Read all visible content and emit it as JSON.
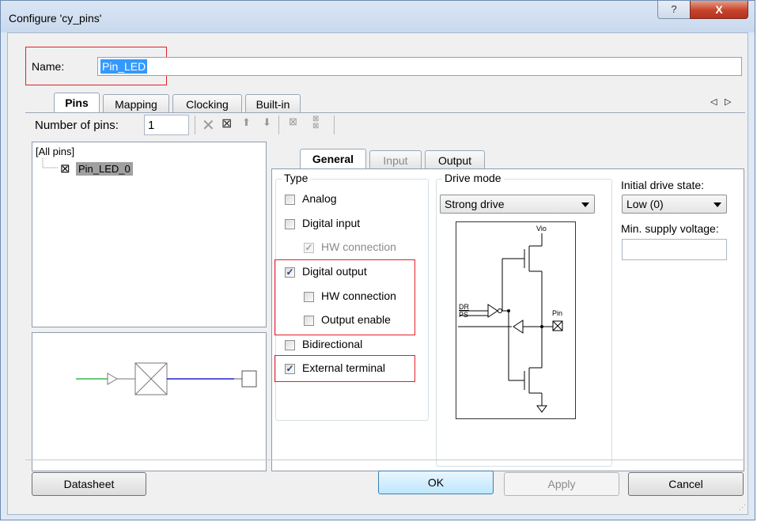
{
  "window": {
    "title": "Configure 'cy_pins'",
    "help_glyph": "?",
    "close_glyph": "X"
  },
  "name_field": {
    "label": "Name:",
    "value": "Pin_LED"
  },
  "top_tabs": [
    {
      "label": "Pins",
      "active": true
    },
    {
      "label": "Mapping",
      "active": false
    },
    {
      "label": "Clocking",
      "active": false
    },
    {
      "label": "Built-in",
      "active": false
    }
  ],
  "tab_scroll": {
    "left": "◁",
    "right": "▷"
  },
  "toolbar": {
    "pins_label": "Number of pins:",
    "pins_value": "1",
    "icons": [
      "delete-icon",
      "add-pin-icon",
      "move-up-icon",
      "move-down-icon",
      "spread-pins-icon",
      "contiguous-pins-icon"
    ]
  },
  "pin_tree": {
    "root": "[All pins]",
    "items": [
      "Pin_LED_0"
    ]
  },
  "sub_tabs": [
    {
      "label": "General",
      "active": true
    },
    {
      "label": "Input",
      "active": false
    },
    {
      "label": "Output",
      "active": false
    }
  ],
  "type_group": {
    "label": "Type",
    "analog": {
      "label": "Analog",
      "checked": false
    },
    "digital_input": {
      "label": "Digital input",
      "checked": false
    },
    "di_hw_connection": {
      "label": "HW connection",
      "checked": true,
      "disabled": true
    },
    "digital_output": {
      "label": "Digital output",
      "checked": true
    },
    "do_hw_connection": {
      "label": "HW connection",
      "checked": false
    },
    "output_enable": {
      "label": "Output enable",
      "checked": false
    },
    "bidirectional": {
      "label": "Bidirectional",
      "checked": false
    },
    "external_terminal": {
      "label": "External terminal",
      "checked": true
    }
  },
  "drive_mode": {
    "label": "Drive mode",
    "value": "Strong drive",
    "schematic": {
      "vio": "Vio",
      "pin": "Pin",
      "dr": "DR",
      "ps": "PS"
    }
  },
  "initial_drive_state": {
    "label": "Initial drive state:",
    "value": "Low (0)"
  },
  "min_supply": {
    "label": "Min. supply voltage:",
    "value": ""
  },
  "buttons": {
    "datasheet": "Datasheet",
    "ok": "OK",
    "apply": "Apply",
    "cancel": "Cancel"
  }
}
